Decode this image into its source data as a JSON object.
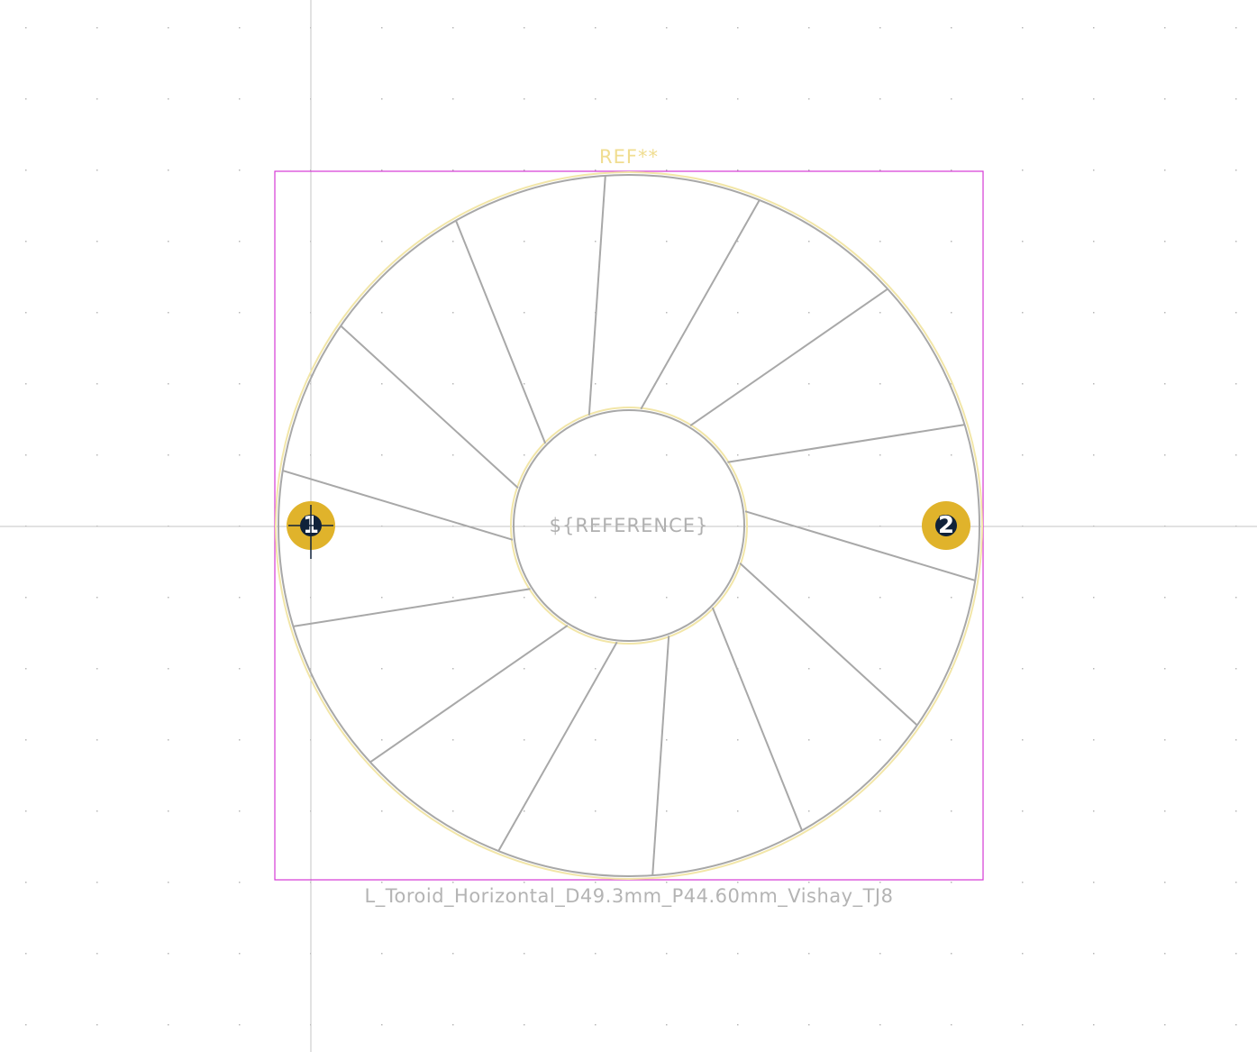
{
  "footprint": {
    "reference": "REF**",
    "value": "L_Toroid_Horizontal_D49.3mm_P44.60mm_Vishay_TJ8",
    "user_text": "${REFERENCE}",
    "pads": [
      {
        "number": "1"
      },
      {
        "number": "2"
      }
    ]
  },
  "colors": {
    "background": "#ffffff",
    "fabrication": "#a8a8a8",
    "silkscreen": "#f2e6a8",
    "courtyard": "#d63ad6",
    "pad": "#e0b32b",
    "drill": "#10223a",
    "grid": "#b8b8b8"
  },
  "icons": {
    "origin_marker": "crosshair-icon"
  }
}
